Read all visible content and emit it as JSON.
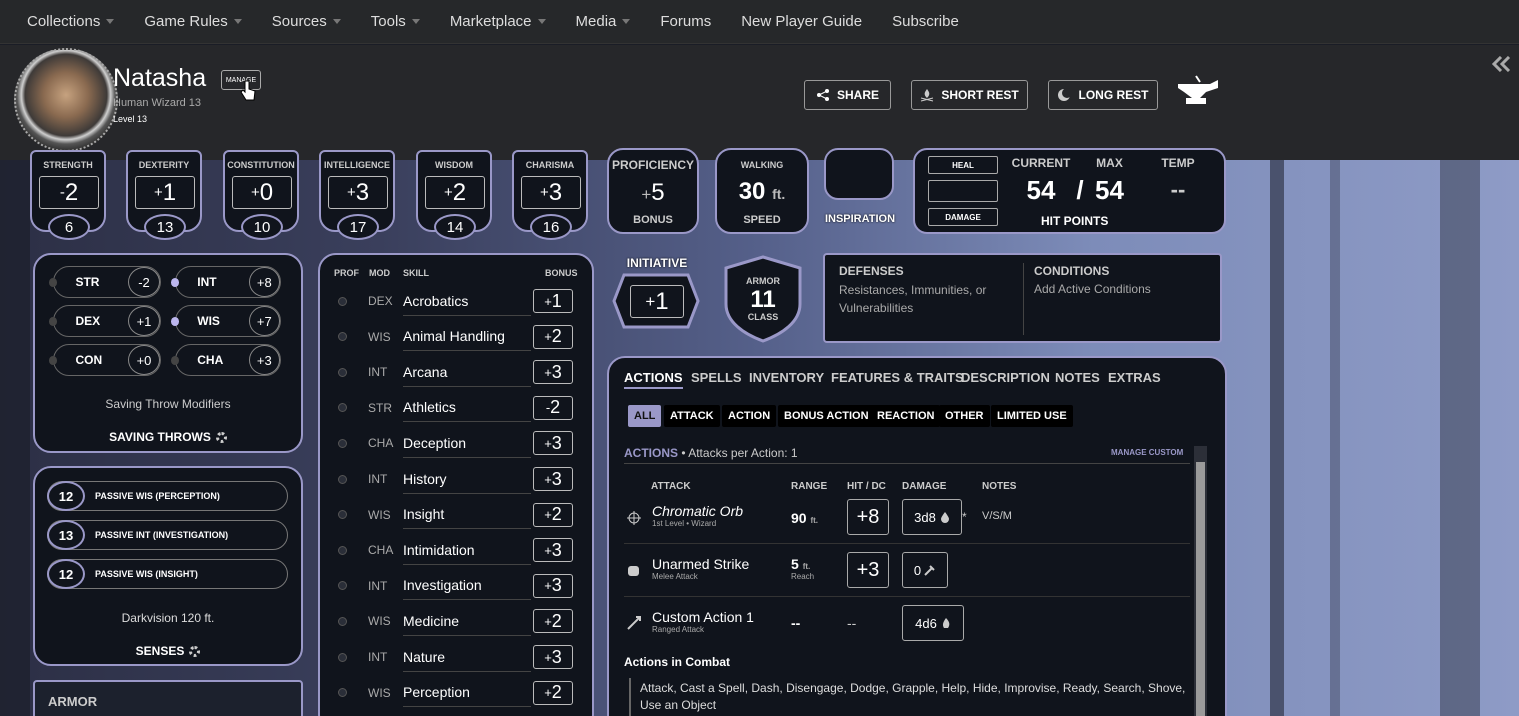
{
  "nav": {
    "items": [
      {
        "label": "Collections"
      },
      {
        "label": "Game Rules"
      },
      {
        "label": "Sources"
      },
      {
        "label": "Tools"
      },
      {
        "label": "Marketplace"
      },
      {
        "label": "Media"
      },
      {
        "label": "Forums"
      },
      {
        "label": "New Player Guide"
      },
      {
        "label": "Subscribe"
      }
    ]
  },
  "character": {
    "name": "Natasha",
    "race_class": "Human  Wizard 13",
    "level": "Level 13",
    "manage_label": "MANAGE"
  },
  "header_buttons": {
    "share": "SHARE",
    "short_rest": "SHORT REST",
    "long_rest": "LONG REST"
  },
  "abilities": [
    {
      "label": "STRENGTH",
      "sign": "-",
      "mod": "2",
      "score": "6"
    },
    {
      "label": "DEXTERITY",
      "sign": "+",
      "mod": "1",
      "score": "13"
    },
    {
      "label": "CONSTITUTION",
      "sign": "+",
      "mod": "0",
      "score": "10"
    },
    {
      "label": "INTELLIGENCE",
      "sign": "+",
      "mod": "3",
      "score": "17"
    },
    {
      "label": "WISDOM",
      "sign": "+",
      "mod": "2",
      "score": "14"
    },
    {
      "label": "CHARISMA",
      "sign": "+",
      "mod": "3",
      "score": "16"
    }
  ],
  "proficiency": {
    "label": "PROFICIENCY",
    "sign": "+",
    "value": "5",
    "sublabel": "BONUS"
  },
  "speed": {
    "label": "WALKING",
    "value": "30",
    "unit": "ft.",
    "sublabel": "SPEED"
  },
  "inspiration": {
    "label": "INSPIRATION"
  },
  "hit_points": {
    "heal": "HEAL",
    "damage": "DAMAGE",
    "current_label": "CURRENT",
    "max_label": "MAX",
    "temp_label": "TEMP",
    "current": "54",
    "slash": "/",
    "max": "54",
    "temp": "--",
    "label": "HIT POINTS"
  },
  "saving_throws": {
    "items": [
      {
        "name": "STR",
        "value": "-2"
      },
      {
        "name": "INT",
        "value": "+8"
      },
      {
        "name": "DEX",
        "value": "+1"
      },
      {
        "name": "WIS",
        "value": "+7"
      },
      {
        "name": "CON",
        "value": "+0"
      },
      {
        "name": "CHA",
        "value": "+3"
      }
    ],
    "modifiers_label": "Saving Throw Modifiers",
    "title": "SAVING THROWS"
  },
  "senses": {
    "items": [
      {
        "value": "12",
        "label": "PASSIVE WIS (PERCEPTION)"
      },
      {
        "value": "13",
        "label": "PASSIVE INT (INVESTIGATION)"
      },
      {
        "value": "12",
        "label": "PASSIVE WIS (INSIGHT)"
      }
    ],
    "darkvision": "Darkvision 120 ft.",
    "title": "SENSES"
  },
  "armor_section": {
    "title": "ARMOR"
  },
  "skills": {
    "headers": {
      "prof": "PROF",
      "mod": "MOD",
      "skill": "SKILL",
      "bonus": "BONUS"
    },
    "rows": [
      {
        "mod": "DEX",
        "name": "Acrobatics",
        "sign": "+",
        "value": "1"
      },
      {
        "mod": "WIS",
        "name": "Animal Handling",
        "sign": "+",
        "value": "2"
      },
      {
        "mod": "INT",
        "name": "Arcana",
        "sign": "+",
        "value": "3"
      },
      {
        "mod": "STR",
        "name": "Athletics",
        "sign": "-",
        "value": "2"
      },
      {
        "mod": "CHA",
        "name": "Deception",
        "sign": "+",
        "value": "3"
      },
      {
        "mod": "INT",
        "name": "History",
        "sign": "+",
        "value": "3"
      },
      {
        "mod": "WIS",
        "name": "Insight",
        "sign": "+",
        "value": "2"
      },
      {
        "mod": "CHA",
        "name": "Intimidation",
        "sign": "+",
        "value": "3"
      },
      {
        "mod": "INT",
        "name": "Investigation",
        "sign": "+",
        "value": "3"
      },
      {
        "mod": "WIS",
        "name": "Medicine",
        "sign": "+",
        "value": "2"
      },
      {
        "mod": "INT",
        "name": "Nature",
        "sign": "+",
        "value": "3"
      },
      {
        "mod": "WIS",
        "name": "Perception",
        "sign": "+",
        "value": "2"
      }
    ]
  },
  "initiative": {
    "label": "INITIATIVE",
    "sign": "+",
    "value": "1"
  },
  "armor_class": {
    "top": "ARMOR",
    "value": "11",
    "bottom": "CLASS"
  },
  "defenses": {
    "title": "DEFENSES",
    "text": "Resistances, Immunities, or Vulnerabilities"
  },
  "conditions": {
    "title": "CONDITIONS",
    "text": "Add Active Conditions"
  },
  "tabs": [
    {
      "label": "ACTIONS"
    },
    {
      "label": "SPELLS"
    },
    {
      "label": "INVENTORY"
    },
    {
      "label": "FEATURES & TRAITS"
    },
    {
      "label": "DESCRIPTION"
    },
    {
      "label": "NOTES"
    },
    {
      "label": "EXTRAS"
    }
  ],
  "filters": [
    {
      "label": "ALL"
    },
    {
      "label": "ATTACK"
    },
    {
      "label": "ACTION"
    },
    {
      "label": "BONUS ACTION"
    },
    {
      "label": "REACTION"
    },
    {
      "label": "OTHER"
    },
    {
      "label": "LIMITED USE"
    }
  ],
  "actions": {
    "title": "ACTIONS",
    "subtitle": "• Attacks per Action: 1",
    "manage_custom": "MANAGE CUSTOM",
    "headers": {
      "attack": "ATTACK",
      "range": "RANGE",
      "hit": "HIT / DC",
      "damage": "DAMAGE",
      "notes": "NOTES"
    },
    "rows": [
      {
        "name": "Chromatic Orb",
        "sub": "1st Level • Wizard",
        "range": "90",
        "range_unit": "ft.",
        "range_sub": "",
        "hit": "+8",
        "damage": "3d8",
        "asterisk": "*",
        "notes": "V/S/M"
      },
      {
        "name": "Unarmed Strike",
        "sub": "Melee Attack",
        "range": "5",
        "range_unit": "ft.",
        "range_sub": "Reach",
        "hit": "+3",
        "damage": "0",
        "asterisk": "",
        "notes": ""
      },
      {
        "name": "Custom Action 1",
        "sub": "Ranged Attack",
        "range": "--",
        "range_unit": "",
        "range_sub": "",
        "hit": "--",
        "damage": "4d6",
        "asterisk": "",
        "notes": ""
      }
    ],
    "combat_title": "Actions in Combat",
    "combat_text": "Attack, Cast a Spell, Dash, Disengage, Dodge, Grapple, Help, Hide, Improvise, Ready, Search, Shove, Use an Object"
  },
  "colors": {
    "accent": "#9a98c8",
    "panel": "#10141c",
    "nav": "#26282a"
  }
}
